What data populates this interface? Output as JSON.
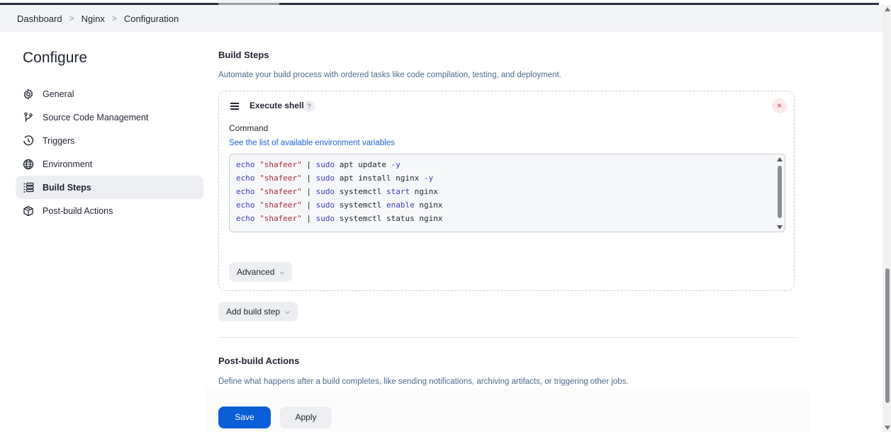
{
  "breadcrumb": [
    "Dashboard",
    "Nginx",
    "Configuration"
  ],
  "sidebar": {
    "title": "Configure",
    "items": [
      {
        "label": "General",
        "icon": "gear-icon"
      },
      {
        "label": "Source Code Management",
        "icon": "branch-icon"
      },
      {
        "label": "Triggers",
        "icon": "clock-icon"
      },
      {
        "label": "Environment",
        "icon": "globe-icon"
      },
      {
        "label": "Build Steps",
        "icon": "list-icon",
        "active": true
      },
      {
        "label": "Post-build Actions",
        "icon": "package-icon"
      }
    ]
  },
  "build_steps": {
    "title": "Build Steps",
    "description": "Automate your build process with ordered tasks like code compilation, testing, and deployment.",
    "step": {
      "title": "Execute shell",
      "help": "?",
      "close": "×",
      "command_label": "Command",
      "env_link": "See the list of available environment variables",
      "code_lines": [
        "echo \"shafeer\" | sudo apt update -y",
        "echo \"shafeer\" | sudo apt install nginx -y",
        "echo \"shafeer\" | sudo systemctl start nginx",
        "echo \"shafeer\" | sudo systemctl enable nginx",
        "echo \"shafeer\" | sudo systemctl status nginx"
      ],
      "advanced_label": "Advanced"
    },
    "add_step_label": "Add build step"
  },
  "post_build": {
    "title": "Post-build Actions",
    "description": "Define what happens after a build completes, like sending notifications, archiving artifacts, or triggering other jobs."
  },
  "footer": {
    "save_label": "Save",
    "apply_label": "Apply"
  },
  "colors": {
    "primary": "#0b5ed7",
    "link": "#1a63d6",
    "danger": "#d6334a"
  }
}
